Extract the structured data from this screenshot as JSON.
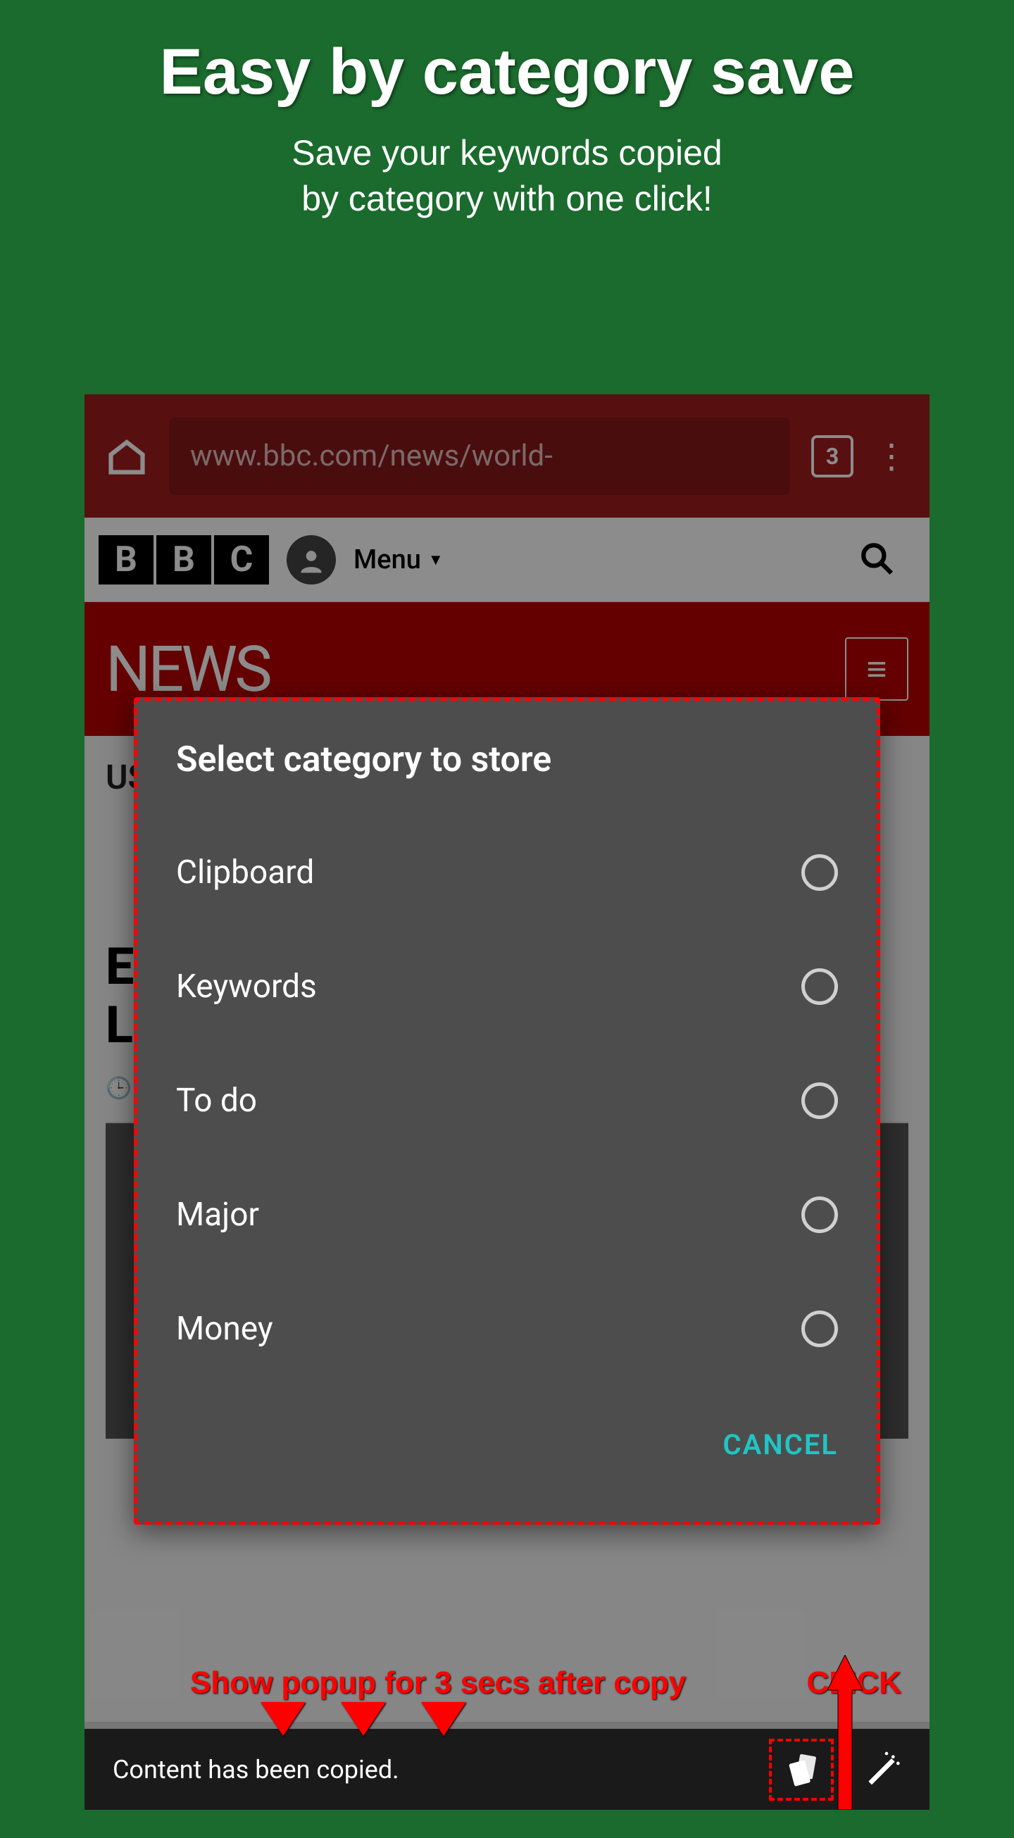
{
  "promo": {
    "title": "Easy by category save",
    "subtitle": "Save your keywords copied\nby category with one click!"
  },
  "browser": {
    "url": "www.bbc.com/news/world-",
    "tab_count": "3"
  },
  "site": {
    "logo_letters": [
      "B",
      "B",
      "C"
    ],
    "menu_label": "Menu",
    "news_label": "NEWS"
  },
  "content": {
    "section": "US",
    "article_title_partial": "E                        g\nL",
    "time_icon": "🕒"
  },
  "dialog": {
    "title": "Select category to store",
    "options": [
      "Clipboard",
      "Keywords",
      "To do",
      "Major",
      "Money"
    ],
    "cancel": "CANCEL"
  },
  "bottom_bar": {
    "status": "Content has been copied."
  },
  "annotations": {
    "popup_hint": "Show popup for 3 secs after copy",
    "click_hint": "CLICK"
  }
}
